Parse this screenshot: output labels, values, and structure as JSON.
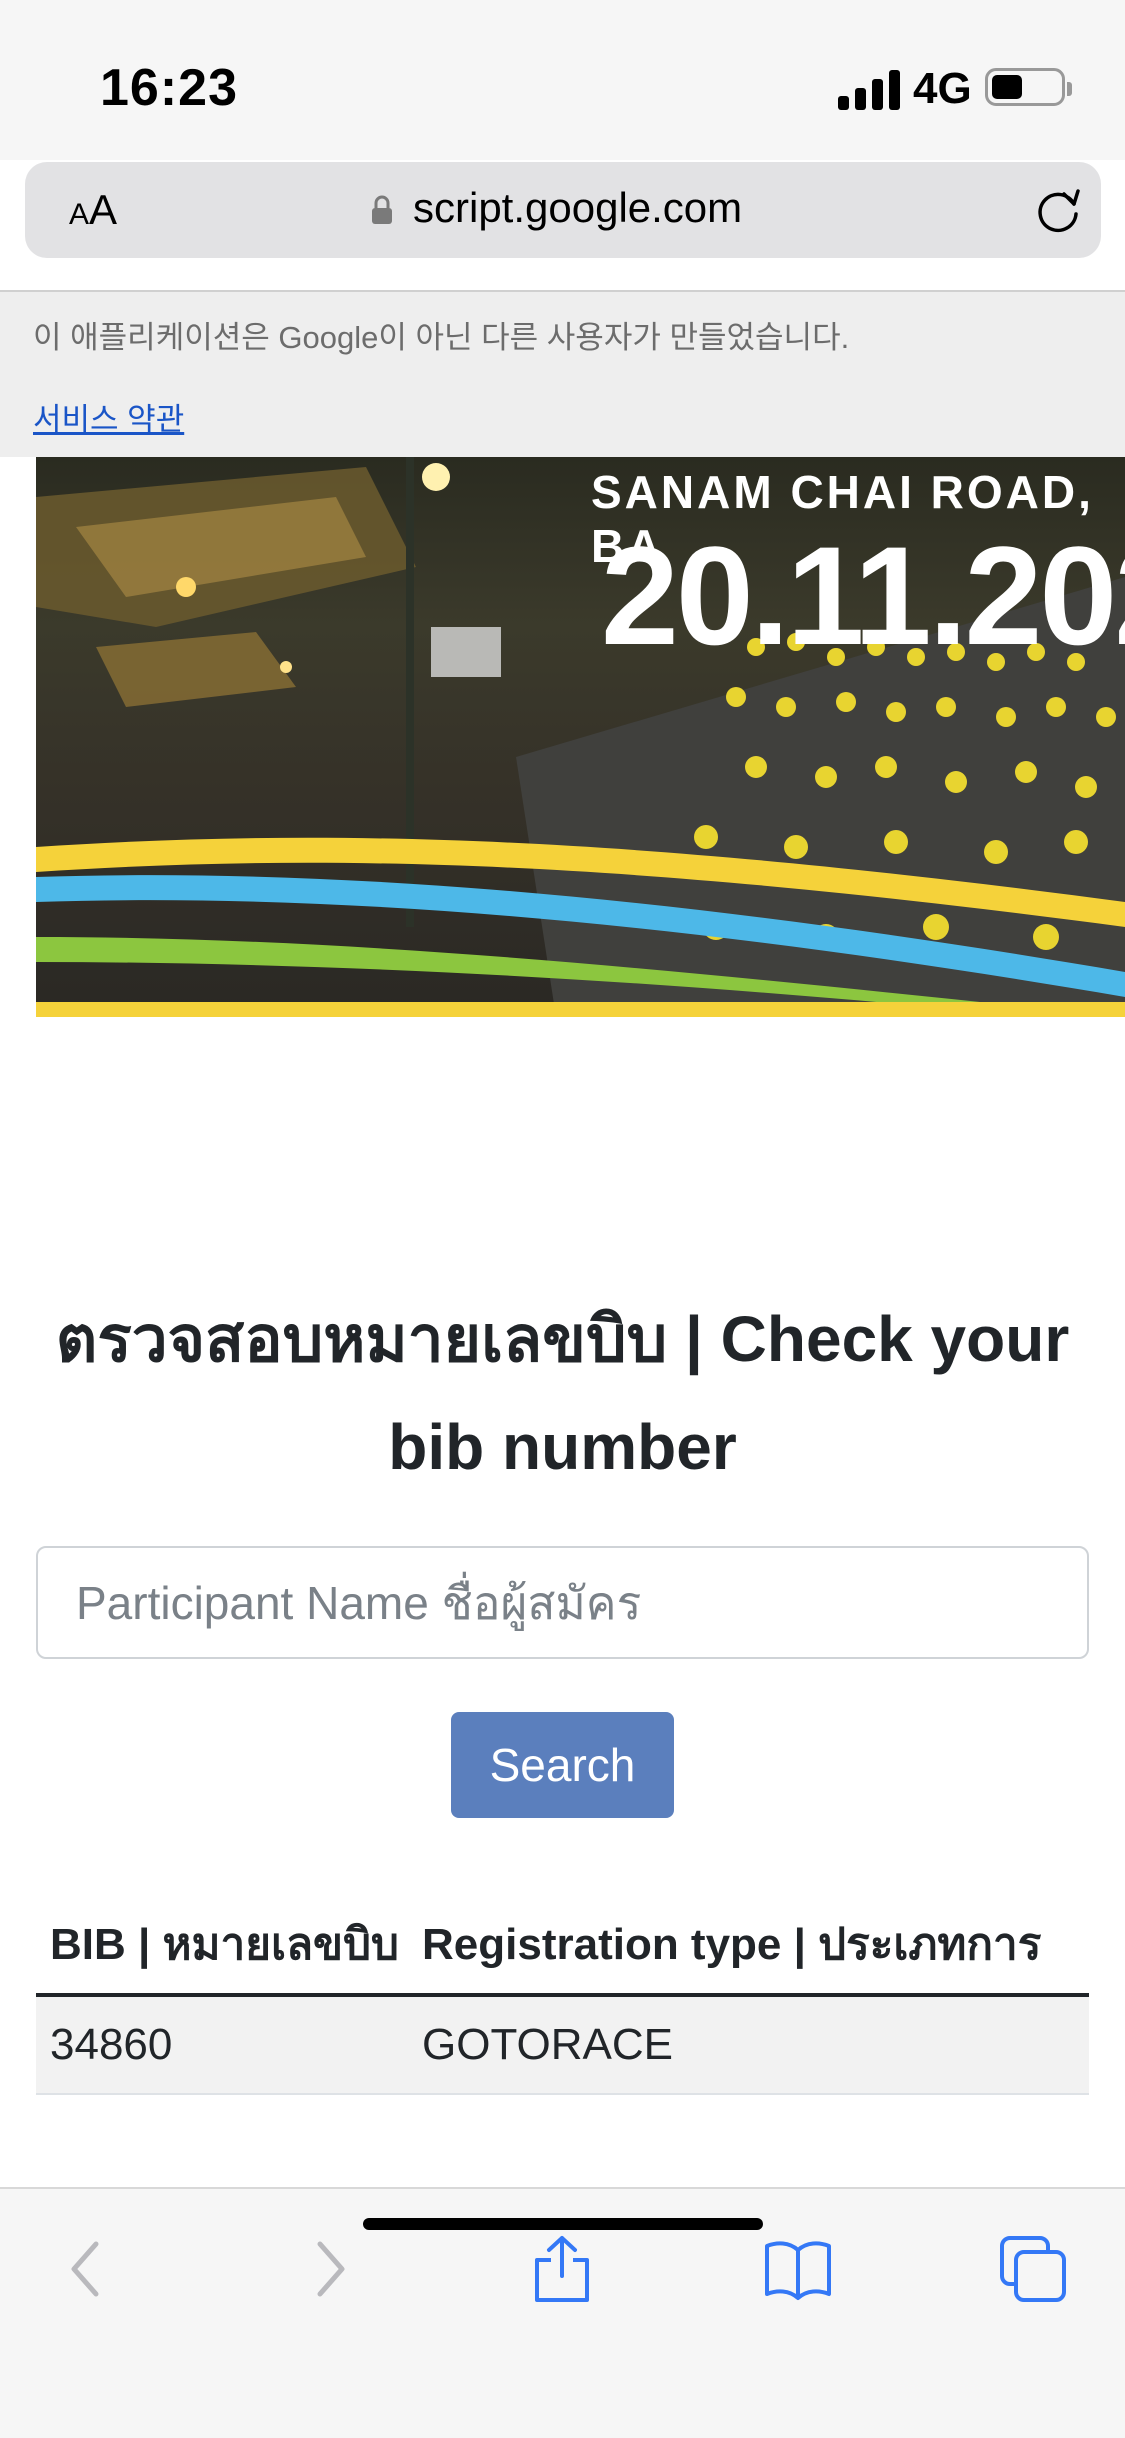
{
  "status_bar": {
    "time": "16:23",
    "network": "4G"
  },
  "browser": {
    "text_size_label": "AA",
    "url": "script.google.com",
    "icons": [
      "lock-icon",
      "reload-icon"
    ]
  },
  "google_notice": {
    "text": "이 애플리케이션은 Google이 아닌 다른 사용자가 만들었습니다.",
    "terms_link": "서비스 약관"
  },
  "banner": {
    "road_text": "SANAM CHAI ROAD, BA",
    "date_text": "20.11.202"
  },
  "main": {
    "heading": "ตรวจสอบหมายเลขบิบ | Check your bib number",
    "search_placeholder": "Participant Name ชื่อผู้สมัคร",
    "search_value": "",
    "search_button": "Search"
  },
  "results": {
    "headers": [
      "BIB | หมายเลขบิบ",
      "Registration type | ประเภทการ"
    ],
    "rows": [
      [
        "34860",
        "GOTORACE"
      ]
    ]
  },
  "toolbar": {
    "icons": [
      "back-icon",
      "forward-icon",
      "share-icon",
      "bookmarks-icon",
      "tabs-icon"
    ]
  },
  "colors": {
    "button": "#5b7fbd",
    "link": "#1a55c7",
    "banner_ribbon_yellow": "#f5d23a",
    "banner_ribbon_blue": "#4db8e8",
    "banner_ribbon_green": "#8cc63f",
    "ios_blue": "#3478f6"
  }
}
